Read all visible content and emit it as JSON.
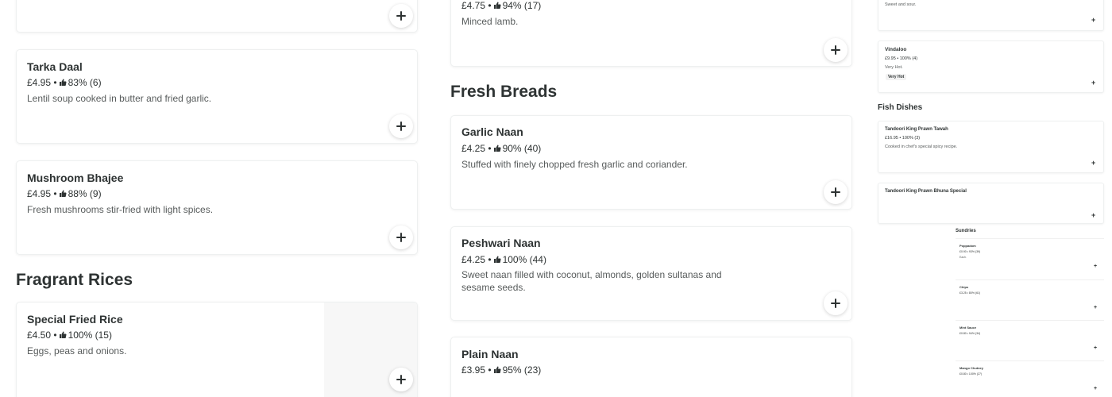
{
  "col1": {
    "top_card": {},
    "items": [
      {
        "name": "Tarka Daal",
        "price": "£4.95",
        "rating": "83% (6)",
        "description": "Lentil soup cooked in butter and fried garlic."
      },
      {
        "name": "Mushroom Bhajee",
        "price": "£4.95",
        "rating": "88% (9)",
        "description": "Fresh mushrooms stir-fried with light spices."
      }
    ],
    "section_title": "Fragrant Rices",
    "rice_items": [
      {
        "name": "Special Fried Rice",
        "price": "£4.50",
        "rating": "100% (15)",
        "description": "Eggs, peas and onions."
      }
    ]
  },
  "col2": {
    "top_card": {
      "price": "£4.75",
      "rating": "94% (17)",
      "description": "Minced lamb."
    },
    "section_title": "Fresh Breads",
    "items": [
      {
        "name": "Garlic Naan",
        "price": "£4.25",
        "rating": "90% (40)",
        "description": "Stuffed with finely chopped fresh garlic and coriander."
      },
      {
        "name": "Peshwari Naan",
        "price": "£4.25",
        "rating": "100% (44)",
        "description": "Sweet naan filled with coconut, almonds, golden sultanas and sesame seeds."
      },
      {
        "name": "Plain Naan",
        "price": "£3.95",
        "rating": "95% (23)",
        "description": ""
      }
    ]
  },
  "col3": {
    "top_desc": "Sweet and sour.",
    "vindaloo": {
      "name": "Vindaloo",
      "meta": "£9.95 • 100% (4)",
      "description": "Very Hot.",
      "tag": "Very Hot"
    },
    "section_title": "Fish Dishes",
    "fish": [
      {
        "name": "Tandoori King Prawn Tawah",
        "meta": "£16.95 • 100% (3)",
        "description": "Cooked in chef's special spicy recipe."
      },
      {
        "name": "Tandoori King Prawn Bhuna Special",
        "meta": "",
        "description": ""
      }
    ],
    "sundries_title": "Sundries",
    "sundries": [
      {
        "name": "Poppadom",
        "meta": "£0.90 • 93% (39)",
        "description": "Each."
      },
      {
        "name": "Chips",
        "meta": "£3.25 • 80% (61)",
        "description": ""
      },
      {
        "name": "Mint Sauce",
        "meta": "£0.80 • 94% (34)",
        "description": ""
      },
      {
        "name": "Mango Chutney",
        "meta": "£0.80 • 100% (27)",
        "description": ""
      }
    ]
  },
  "icons": {
    "add": "plus-icon",
    "rating": "thumbs-up-icon"
  },
  "separator": "•"
}
